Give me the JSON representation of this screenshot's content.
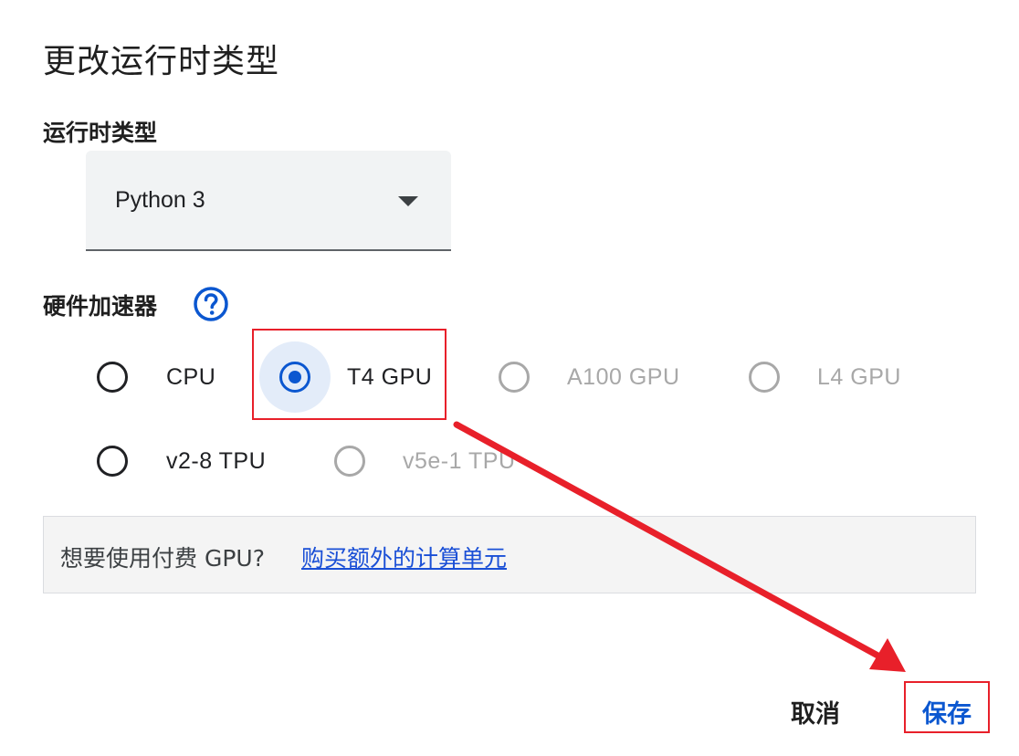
{
  "dialog": {
    "title": "更改运行时类型",
    "runtime": {
      "label": "运行时类型",
      "selected": "Python 3",
      "caret_icon": "dropdown-caret-icon"
    },
    "hardware": {
      "label": "硬件加速器",
      "help_icon": "help-circle-icon",
      "options": [
        {
          "label": "CPU",
          "selected": false,
          "disabled": false
        },
        {
          "label": "T4 GPU",
          "selected": true,
          "disabled": false
        },
        {
          "label": "A100 GPU",
          "selected": false,
          "disabled": true
        },
        {
          "label": "L4 GPU",
          "selected": false,
          "disabled": true
        },
        {
          "label": "v2-8 TPU",
          "selected": false,
          "disabled": false
        },
        {
          "label": "v5e-1 TPU",
          "selected": false,
          "disabled": true
        }
      ]
    },
    "info": {
      "text": "想要使用付费 GPU?",
      "link": "购买额外的计算单元"
    },
    "buttons": {
      "cancel": "取消",
      "save": "保存"
    }
  },
  "annotations": {
    "highlight_color": "#e8202a",
    "accent_color": "#0b57d0"
  }
}
